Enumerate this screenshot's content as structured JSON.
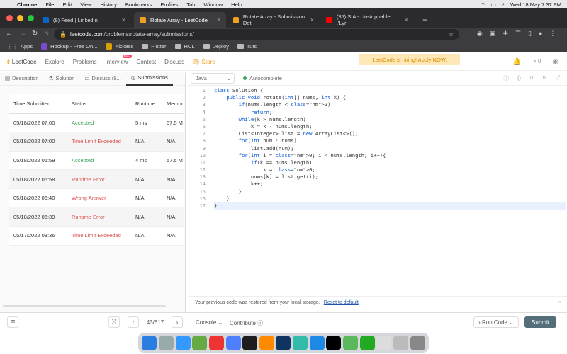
{
  "menubar": {
    "app": "Chrome",
    "items": [
      "File",
      "Edit",
      "View",
      "History",
      "Bookmarks",
      "Profiles",
      "Tab",
      "Window",
      "Help"
    ],
    "clock": "Wed 18 May  7:37 PM"
  },
  "tabs": [
    {
      "label": "(9) Feed | LinkedIn",
      "color": "#0a66c2",
      "glyph": "in"
    },
    {
      "label": "Rotate Array - LeetCode",
      "color": "#f0a020",
      "glyph": "L"
    },
    {
      "label": "Rotate Array - Submission Det",
      "color": "#f0a020",
      "glyph": "L"
    },
    {
      "label": "(35) SIA - Unstoppable .'Lyr",
      "color": "#ff0000",
      "glyph": "▶"
    }
  ],
  "address": {
    "domain": "leetcode.com",
    "path": "/problems/rotate-array/submissions/"
  },
  "bookmarks": [
    "Apps",
    "Hookup - Free On...",
    "Kickass",
    "Flutter",
    "HCL",
    "Deploy",
    "Tuts"
  ],
  "lcnav": {
    "brand": "LeetCode",
    "items": [
      "Explore",
      "Problems",
      "Interview",
      "Contest",
      "Discuss",
      "Store"
    ],
    "new_badge": "New",
    "promo": "LeetCode is hiring! Apply NOW.",
    "coins": "0"
  },
  "subtabs": [
    "Description",
    "Solution",
    "Discuss (9...",
    "Submissions"
  ],
  "submissions": {
    "headers": [
      "Time Submitted",
      "Status",
      "Runtime",
      "Memor"
    ],
    "rows": [
      {
        "time": "05/18/2022 07:00",
        "status": "Accepted",
        "cls": "acc",
        "runtime": "5 ms",
        "memory": "57.5 M"
      },
      {
        "time": "05/18/2022 07:00",
        "status": "Time Limit Exceeded",
        "cls": "err",
        "runtime": "N/A",
        "memory": "N/A"
      },
      {
        "time": "05/18/2022 06:59",
        "status": "Accepted",
        "cls": "acc",
        "runtime": "4 ms",
        "memory": "57.5 M"
      },
      {
        "time": "05/18/2022 06:58",
        "status": "Runtime Error",
        "cls": "err",
        "runtime": "N/A",
        "memory": "N/A"
      },
      {
        "time": "05/18/2022 06:40",
        "status": "Wrong Answer",
        "cls": "err",
        "runtime": "N/A",
        "memory": "N/A"
      },
      {
        "time": "05/18/2022 06:39",
        "status": "Runtime Error",
        "cls": "err",
        "runtime": "N/A",
        "memory": "N/A"
      },
      {
        "time": "05/17/2022 08:36",
        "status": "Time Limit Exceeded",
        "cls": "err",
        "runtime": "N/A",
        "memory": "N/A"
      }
    ]
  },
  "editor": {
    "language": "Java",
    "autocomplete": "Autocomplete",
    "lines": [
      "class Solution {",
      "    public void rotate(int[] nums, int k) {",
      "        if(nums.length < 2)",
      "            return;",
      "        while(k > nums.length)",
      "            k = k - nums.length;",
      "        List<Integer> list = new ArrayList<>();",
      "        for(int num : nums)",
      "            list.add(num);",
      "        for(int i = 0; i < nums.length; i++){",
      "            if(k == nums.length)",
      "                k = 0;",
      "            nums[k] = list.get(i);",
      "            k++;",
      "        }",
      "    }",
      "}"
    ],
    "notice": "Your previous code was restored from your local storage.",
    "reset": "Reset to default"
  },
  "bottom": {
    "page": "43/617",
    "console": "Console",
    "contribute": "Contribute",
    "run": "Run Code",
    "submit": "Submit"
  },
  "dock_colors": [
    "#2a7de1",
    "#9aa",
    "#3399ff",
    "#6a4",
    "#e33",
    "#4d7fff",
    "#1d1d1d",
    "#ff8a00",
    "#0f3460",
    "#3ba",
    "#1e88e5",
    "#000",
    "#5cb85c",
    "#2a2",
    "#ddd",
    "#bbb",
    "#888"
  ]
}
